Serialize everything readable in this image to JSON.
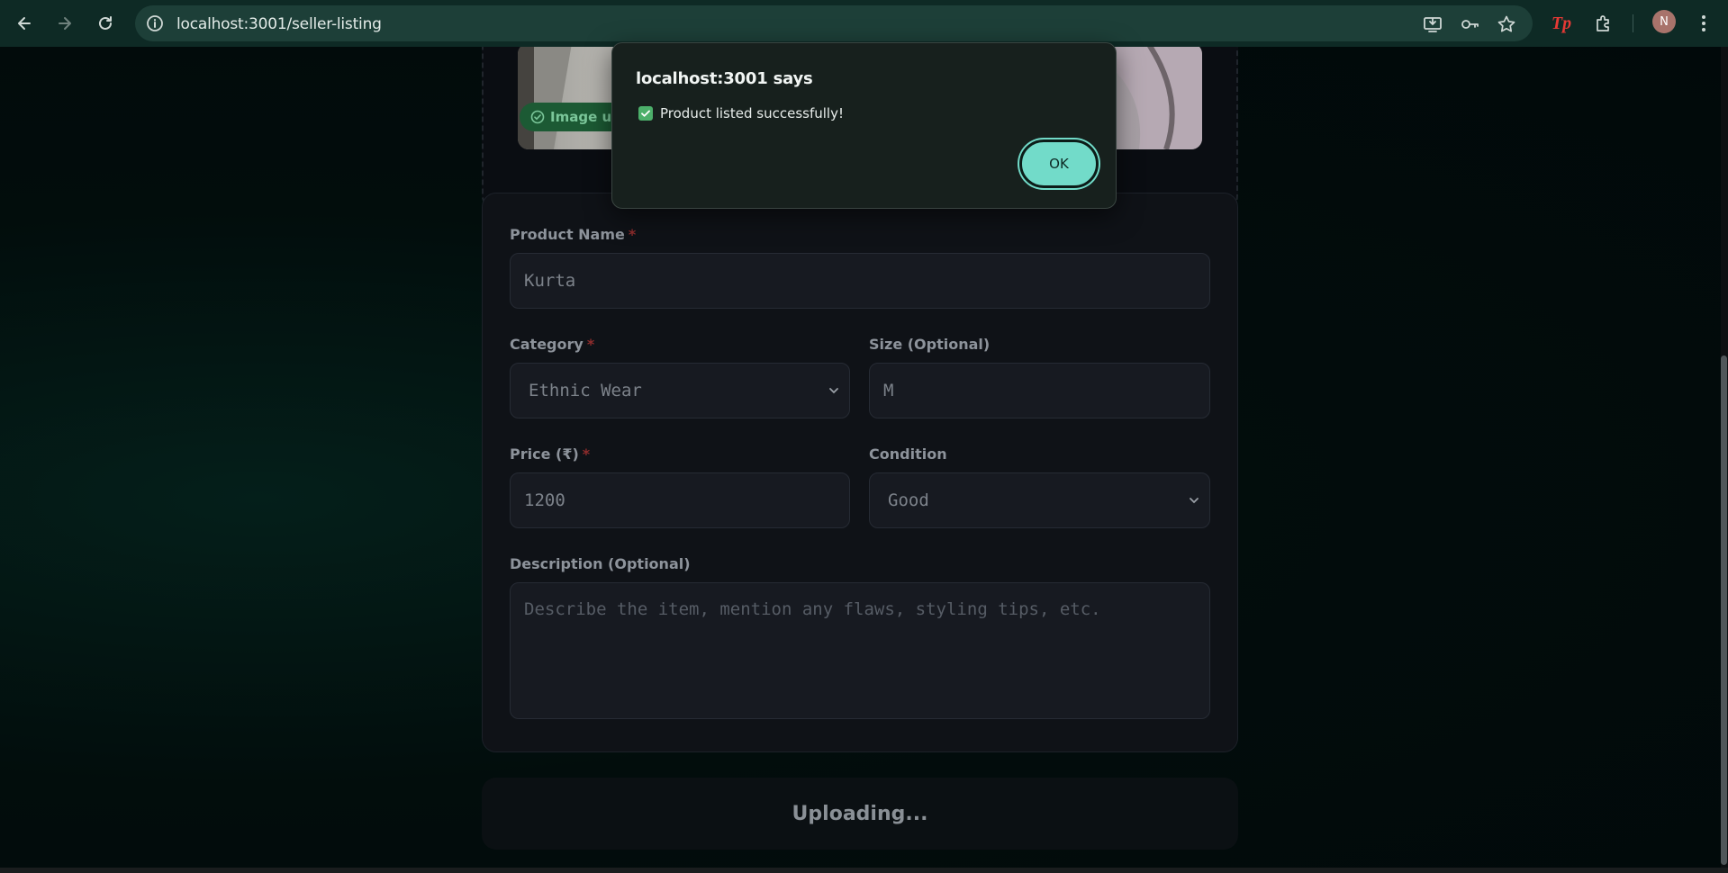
{
  "browser": {
    "url": "localhost:3001/seller-listing",
    "profile_initial": "N",
    "extension_badge": "Tp"
  },
  "upload": {
    "status_badge": "Image up"
  },
  "form": {
    "product_name": {
      "label": "Product Name",
      "required_mark": "*",
      "value": "Kurta"
    },
    "category": {
      "label": "Category",
      "required_mark": "*",
      "selected": "Ethnic Wear"
    },
    "size": {
      "label": "Size (Optional)",
      "value": "M"
    },
    "price": {
      "label": "Price (₹)",
      "required_mark": "*",
      "value": "1200"
    },
    "condition": {
      "label": "Condition",
      "selected": "Good"
    },
    "description": {
      "label": "Description (Optional)",
      "placeholder": "Describe the item, mention any flaws, styling tips, etc."
    }
  },
  "submit": {
    "label": "Uploading..."
  },
  "dialog": {
    "title": "localhost:3001 says",
    "message": "Product listed successfully!",
    "ok_label": "OK"
  },
  "colors": {
    "accent": "#72dbc9",
    "success": "#4caf6a",
    "required": "#8f2c2c"
  }
}
